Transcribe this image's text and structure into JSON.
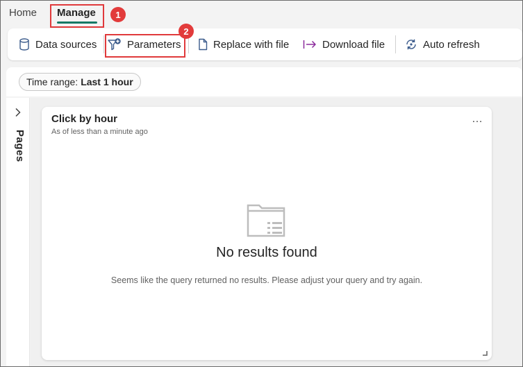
{
  "tabs": [
    {
      "label": "Home",
      "active": false
    },
    {
      "label": "Manage",
      "active": true
    }
  ],
  "toolbar": {
    "data_sources": "Data sources",
    "parameters": "Parameters",
    "replace_with_file": "Replace with file",
    "download_file": "Download file",
    "auto_refresh": "Auto refresh"
  },
  "filter": {
    "time_range_label": "Time range:",
    "time_range_value": "Last 1 hour"
  },
  "pages_panel": {
    "label": "Pages"
  },
  "card": {
    "title": "Click by hour",
    "subtitle": "As of less than a minute ago",
    "more": "…",
    "empty_title": "No results found",
    "empty_desc": "Seems like the query returned no results. Please adjust your query and try again."
  },
  "annotations": {
    "step1": "1",
    "step2": "2",
    "color": "#e0393b"
  },
  "colors": {
    "accent": "#117865",
    "download_icon": "#8b2b9c",
    "icon_blue": "#3b5b8c"
  },
  "icons": [
    "database-icon",
    "filter-add-icon",
    "document-icon",
    "arrow-export-icon",
    "sync-icon",
    "chevron-right-icon",
    "folder-list-icon",
    "more-icon",
    "resize-icon"
  ]
}
